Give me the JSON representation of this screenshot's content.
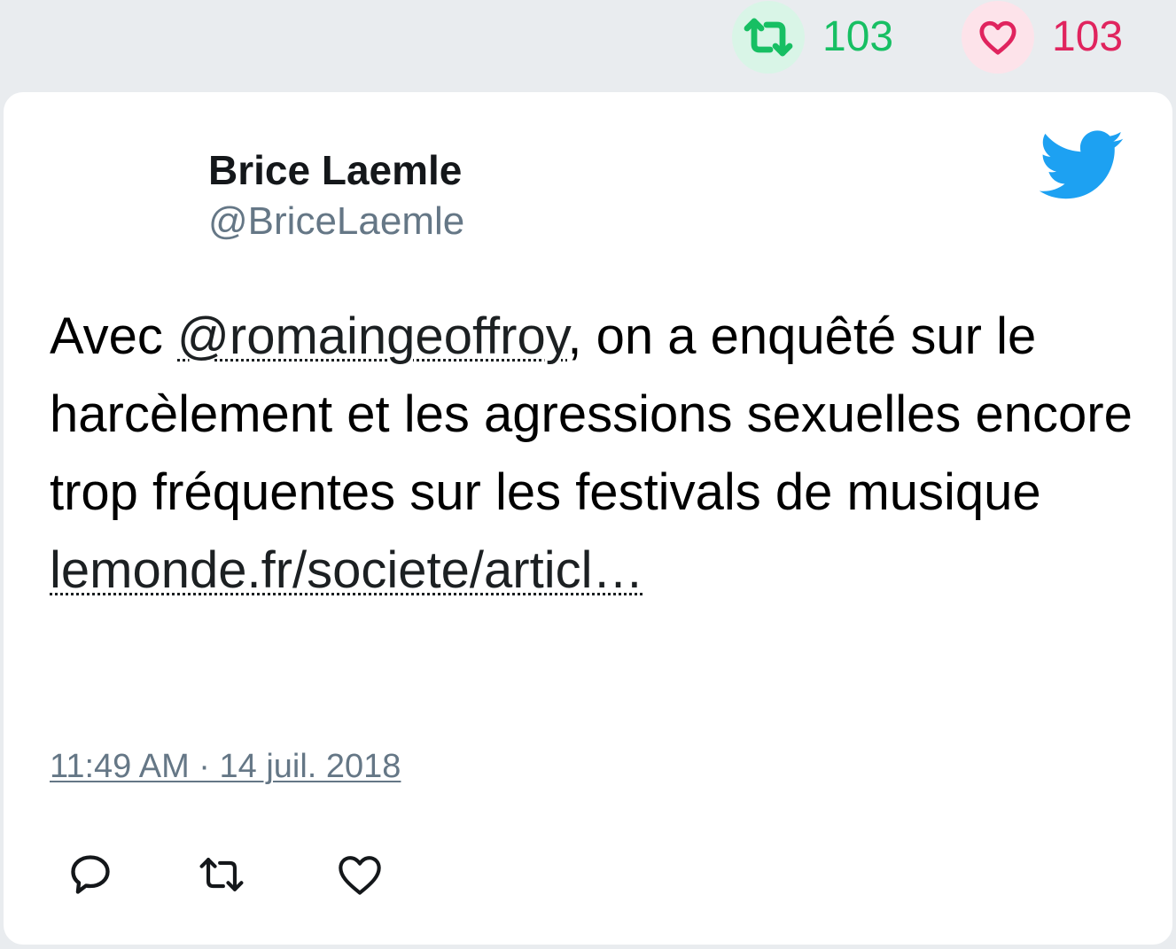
{
  "stats": {
    "retweet_count": "103",
    "like_count": "103"
  },
  "author": {
    "name": "Brice Laemle",
    "handle": "@BriceLaemle"
  },
  "tweet": {
    "text_before": "Avec ",
    "mention": "@romaingeoffroy",
    "text_after": ", on a enquêté sur le harcèlement et les agressions sexuelles encore trop fréquentes sur les festivals de musique ",
    "link": "lemonde.fr/societe/articl…"
  },
  "timestamp": "11:49 AM · 14 juil. 2018",
  "icons": {
    "top_retweet": "retweet-icon",
    "top_like": "heart-icon",
    "brand": "twitter-bird-icon",
    "reply": "reply-icon",
    "retweet": "retweet-icon",
    "like": "heart-icon"
  },
  "colors": {
    "retweet": "#17bf63",
    "like": "#e0245e",
    "twitter_blue": "#1da1f2",
    "secondary_text": "#657786"
  }
}
